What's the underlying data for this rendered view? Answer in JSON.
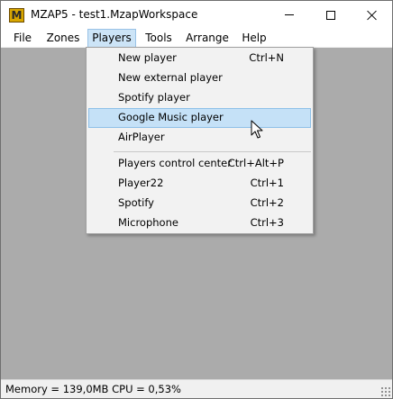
{
  "window": {
    "title": "MZAP5 - test1.MzapWorkspace",
    "app_icon_letter": "M",
    "icons": {
      "app": "mzap-app-icon",
      "minimize": "minimize-icon",
      "maximize": "maximize-icon",
      "close": "close-icon",
      "cursor": "pointer-cursor-icon"
    }
  },
  "menubar": {
    "items": [
      {
        "label": "File"
      },
      {
        "label": "Zones"
      },
      {
        "label": "Players"
      },
      {
        "label": "Tools"
      },
      {
        "label": "Arrange"
      },
      {
        "label": "Help"
      }
    ],
    "active": "Players"
  },
  "players_menu": {
    "items": [
      {
        "label": "New player",
        "shortcut": "Ctrl+N"
      },
      {
        "label": "New external player",
        "shortcut": ""
      },
      {
        "label": "Spotify player",
        "shortcut": ""
      },
      {
        "label": "Google Music player",
        "shortcut": ""
      },
      {
        "label": "AirPlayer",
        "shortcut": ""
      },
      {
        "label": "Players control center",
        "shortcut": "Ctrl+Alt+P"
      },
      {
        "label": "Player22",
        "shortcut": "Ctrl+1"
      },
      {
        "label": "Spotify",
        "shortcut": "Ctrl+2"
      },
      {
        "label": "Microphone",
        "shortcut": "Ctrl+3"
      }
    ],
    "highlighted": "Google Music player"
  },
  "statusbar": {
    "text": "Memory = 139,0MB CPU = 0,53%"
  },
  "colors": {
    "client_background": "#ababab",
    "menu_background": "#f2f2f2",
    "highlight": "#c5e1f7",
    "highlight_border": "#8ec0e8",
    "active_menu": "#cce4f7"
  }
}
